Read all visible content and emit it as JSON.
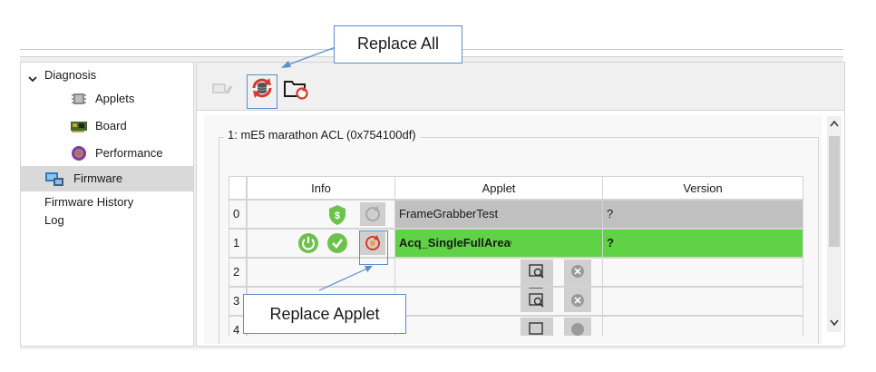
{
  "tree": {
    "diagnosis_label": "Diagnosis",
    "applets_label": "Applets",
    "board_label": "Board",
    "performance_label": "Performance",
    "firmware_label": "Firmware",
    "firmware_history_label": "Firmware History",
    "log_label": "Log"
  },
  "toolbar": {
    "icons": [
      "upload-firmware-icon",
      "replace-all-icon",
      "folder-replace-icon"
    ]
  },
  "group": {
    "title": "1:  mE5 marathon ACL (0x754100df)"
  },
  "table": {
    "headers": [
      "Info",
      "Applet",
      "Version"
    ],
    "rows": [
      {
        "index": "0",
        "applet": "FrameGrabberTest",
        "version": "?"
      },
      {
        "index": "1",
        "applet": "Acq_SingleFullAreaGr",
        "version": "?"
      },
      {
        "index": "2",
        "applet": "",
        "version": ""
      },
      {
        "index": "3",
        "applet": "",
        "version": ""
      },
      {
        "index": "4",
        "applet": "",
        "version": ""
      }
    ]
  },
  "callouts": {
    "replace_all": "Replace All",
    "replace_applet": "Replace Applet"
  },
  "colors": {
    "accent_green": "#5fd246",
    "row_gray": "#c0c0c0",
    "selection": "#d9d9d9",
    "callout_border": "#5b8fc7",
    "replace_red": "#d9372e"
  }
}
